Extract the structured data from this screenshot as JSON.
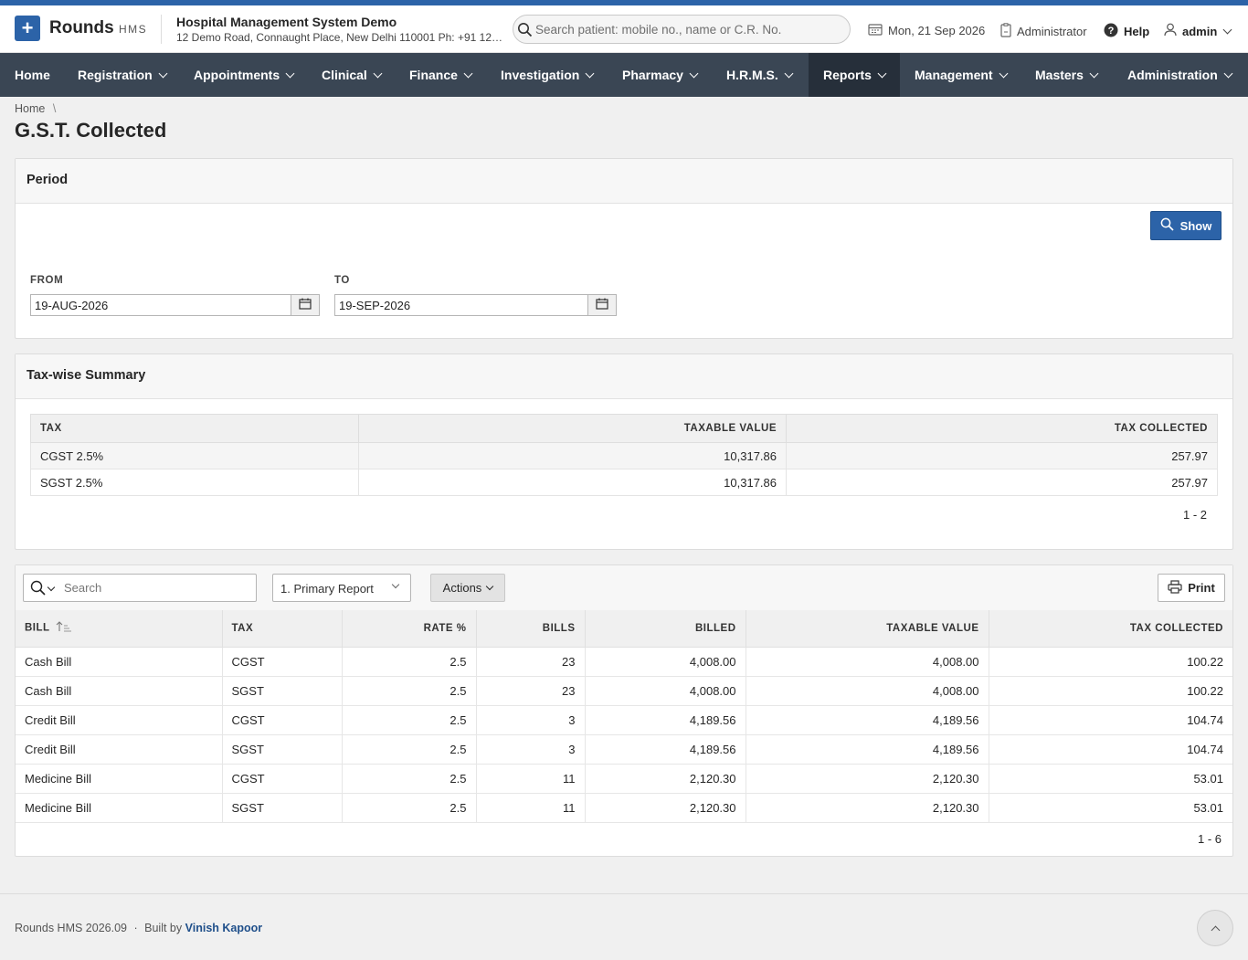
{
  "header": {
    "brand": "Rounds",
    "brand_sub": "HMS",
    "org_name": "Hospital Management System Demo",
    "org_address": "12 Demo Road, Connaught Place, New Delhi 110001 Ph: +91 123...",
    "search_placeholder": "Search patient: mobile no., name or C.R. No.",
    "date": "Mon, 21 Sep 2026",
    "role": "Administrator",
    "help": "Help",
    "user": "admin"
  },
  "nav": {
    "items": [
      "Home",
      "Registration",
      "Appointments",
      "Clinical",
      "Finance",
      "Investigation",
      "Pharmacy",
      "H.R.M.S.",
      "Reports",
      "Management",
      "Masters",
      "Administration"
    ],
    "active": "Reports"
  },
  "breadcrumb": {
    "home": "Home",
    "sep": "\\"
  },
  "page_title": "G.S.T. Collected",
  "period": {
    "title": "Period",
    "show_label": "Show",
    "from_label": "FROM",
    "from_value": "19-AUG-2026",
    "to_label": "TO",
    "to_value": "19-SEP-2026"
  },
  "summary": {
    "title": "Tax-wise Summary",
    "headers": [
      "TAX",
      "TAXABLE VALUE",
      "TAX COLLECTED"
    ],
    "rows": [
      [
        "CGST 2.5%",
        "10,317.86",
        "257.97"
      ],
      [
        "SGST 2.5%",
        "10,317.86",
        "257.97"
      ]
    ],
    "pager": "1 - 2"
  },
  "report": {
    "search_placeholder": "Search",
    "report_select": "1. Primary Report",
    "actions_label": "Actions",
    "print_label": "Print",
    "headers": [
      "BILL",
      "TAX",
      "RATE %",
      "BILLS",
      "BILLED",
      "TAXABLE VALUE",
      "TAX COLLECTED"
    ],
    "rows": [
      [
        "Cash Bill",
        "CGST",
        "2.5",
        "23",
        "4,008.00",
        "4,008.00",
        "100.22"
      ],
      [
        "Cash Bill",
        "SGST",
        "2.5",
        "23",
        "4,008.00",
        "4,008.00",
        "100.22"
      ],
      [
        "Credit Bill",
        "CGST",
        "2.5",
        "3",
        "4,189.56",
        "4,189.56",
        "104.74"
      ],
      [
        "Credit Bill",
        "SGST",
        "2.5",
        "3",
        "4,189.56",
        "4,189.56",
        "104.74"
      ],
      [
        "Medicine Bill",
        "CGST",
        "2.5",
        "11",
        "2,120.30",
        "2,120.30",
        "53.01"
      ],
      [
        "Medicine Bill",
        "SGST",
        "2.5",
        "11",
        "2,120.30",
        "2,120.30",
        "53.01"
      ]
    ],
    "pager": "1 - 6"
  },
  "footer": {
    "version": "Rounds HMS 2026.09",
    "dot": "·",
    "built_by": "Built by",
    "author": "Vinish Kapoor"
  },
  "colors": {
    "brand": "#2c63a8",
    "nav_bg": "#3a4654",
    "nav_active": "#262f3a"
  }
}
